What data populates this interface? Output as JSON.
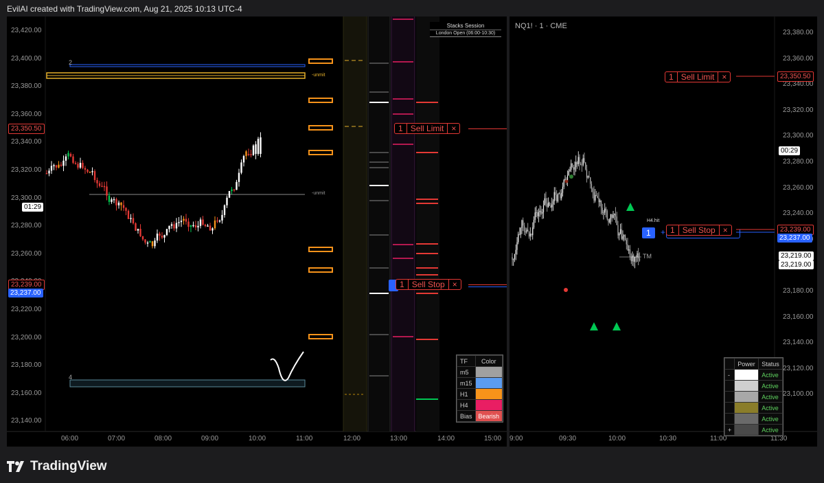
{
  "header": {
    "text": "EvilAI created with TradingView.com, Aug 21, 2025 10:13 UTC-4"
  },
  "footer": {
    "brand": "TradingView",
    "logo_icon": "tradingview-logo-icon"
  },
  "left_chart": {
    "price_axis": [
      "23,420.00",
      "23,400.00",
      "23,380.00",
      "23,360.00",
      "23,340.00",
      "23,320.00",
      "23,300.00",
      "23,280.00",
      "23,260.00",
      "23,240.00",
      "23,220.00",
      "23,200.00",
      "23,180.00",
      "23,160.00",
      "23,140.00"
    ],
    "time_axis": [
      "06:00",
      "07:00",
      "08:00",
      "09:00",
      "10:00",
      "11:00",
      "12:00",
      "13:00",
      "14:00",
      "15:00"
    ],
    "price_tags": {
      "sell_limit_price": "23,350.50",
      "sell_stop_price": "23,239.00",
      "buy_price": "23,237.00"
    },
    "countdown": "01:29",
    "zone_labels": {
      "upper": "2",
      "lower": "4"
    },
    "unmit_labels": [
      "-unmit",
      "-unmit"
    ],
    "session_box": {
      "title": "Stacks Session",
      "subtitle": "London Open (06:00-10:30)"
    },
    "orders": [
      {
        "qty": "1",
        "label": "Sell Limit",
        "close": "×"
      },
      {
        "qty": "1",
        "label": "Sell Stop",
        "close": "×"
      }
    ],
    "tf_legend": {
      "headers": [
        "TF",
        "Color"
      ],
      "rows": [
        {
          "tf": "m5",
          "color": "#a0a0a0",
          "text": ""
        },
        {
          "tf": "m15",
          "color": "#5b9cf0",
          "text": ""
        },
        {
          "tf": "H1",
          "color": "#f7931a",
          "text": ""
        },
        {
          "tf": "H4",
          "color": "#e91e63",
          "text": ""
        },
        {
          "tf": "Bias",
          "color": "#e05050",
          "text": "Bearish"
        }
      ]
    }
  },
  "right_chart": {
    "symbol": "NQ1! · 1 · CME",
    "price_axis": [
      "23,380.00",
      "23,360.00",
      "23,340.00",
      "23,320.00",
      "23,300.00",
      "23,280.00",
      "23,260.00",
      "23,240.00",
      "23,220.00",
      "23,200.00",
      "23,180.00",
      "23,160.00",
      "23,140.00",
      "23,120.00",
      "23,100.00"
    ],
    "time_axis": [
      "9:00",
      "09:30",
      "10:00",
      "10:30",
      "11:00",
      "11:30"
    ],
    "price_tags": {
      "sell_limit_price": "23,350.50",
      "sell_stop_price": "23,239.00",
      "buy_price": "23,237.00",
      "current_a": "23,219.00",
      "current_b": "23,219.00"
    },
    "countdown": "00:29",
    "orders": [
      {
        "qty": "1",
        "label": "Sell Limit",
        "close": "×"
      },
      {
        "qty": "1",
        "label": "Sell Stop",
        "close": "×"
      }
    ],
    "buy_tag": {
      "qty": "1",
      "plus": "+"
    },
    "annotations": {
      "tm": "TM",
      "h4hit": "H4.hit"
    },
    "power_legend": {
      "headers": [
        "Power",
        "Status"
      ],
      "rows": [
        {
          "sign": "-",
          "color": "#ffffff",
          "status": "Active"
        },
        {
          "sign": "",
          "color": "#cfcfcf",
          "status": "Active"
        },
        {
          "sign": "",
          "color": "#a8a8a8",
          "status": "Active"
        },
        {
          "sign": "",
          "color": "#8a7d2a",
          "status": "Active"
        },
        {
          "sign": "",
          "color": "#6a6a6a",
          "status": "Active"
        },
        {
          "sign": "+",
          "color": "#4a4a4a",
          "status": "Active"
        }
      ]
    }
  },
  "colors": {
    "bull": "#ffffff",
    "bear": "#e53935",
    "sell": "#e53935",
    "buy": "#2962ff",
    "orange": "#f7931a",
    "green": "#00c853"
  }
}
